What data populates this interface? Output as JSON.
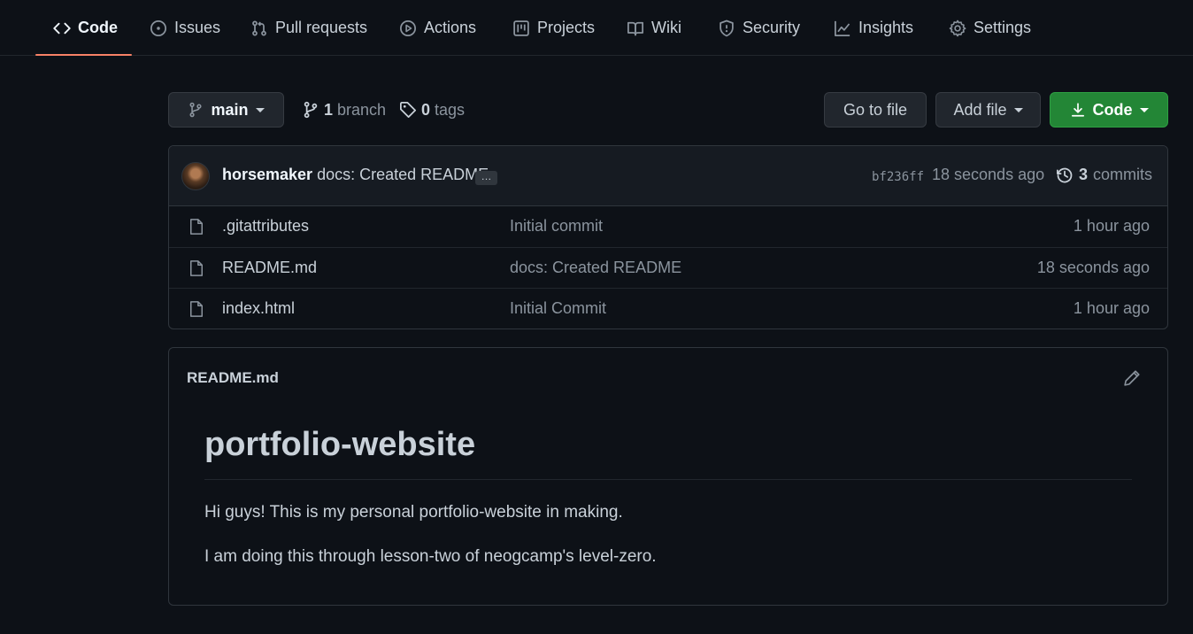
{
  "nav": {
    "tabs": [
      {
        "label": "Code",
        "icon": "code-icon"
      },
      {
        "label": "Issues",
        "icon": "issue-icon"
      },
      {
        "label": "Pull requests",
        "icon": "pull-request-icon"
      },
      {
        "label": "Actions",
        "icon": "play-icon"
      },
      {
        "label": "Projects",
        "icon": "project-icon"
      },
      {
        "label": "Wiki",
        "icon": "book-icon"
      },
      {
        "label": "Security",
        "icon": "shield-icon"
      },
      {
        "label": "Insights",
        "icon": "graph-icon"
      },
      {
        "label": "Settings",
        "icon": "gear-icon"
      }
    ],
    "active": "Code"
  },
  "toolbar": {
    "branch": "main",
    "branch_count": "1",
    "branch_label": "branch",
    "tag_count": "0",
    "tag_label": "tags",
    "go_to_file": "Go to file",
    "add_file": "Add file",
    "code": "Code"
  },
  "commit": {
    "author": "horsemaker",
    "message": "docs: Created README",
    "ellipsis": "…",
    "sha": "bf236ff",
    "age": "18 seconds ago",
    "count": "3",
    "count_label": "commits"
  },
  "files": [
    {
      "name": ".gitattributes",
      "message": "Initial commit",
      "age": "1 hour ago"
    },
    {
      "name": "README.md",
      "message": "docs: Created README",
      "age": "18 seconds ago"
    },
    {
      "name": "index.html",
      "message": "Initial Commit",
      "age": "1 hour ago"
    }
  ],
  "readme": {
    "filename": "README.md",
    "heading": "portfolio-website",
    "paragraphs": [
      "Hi guys! This is my personal portfolio-website in making.",
      "I am doing this through lesson-two of neogcamp's level-zero."
    ]
  },
  "colors": {
    "background": "#0d1117",
    "accent_underline": "#f78166",
    "primary_button": "#238636"
  }
}
